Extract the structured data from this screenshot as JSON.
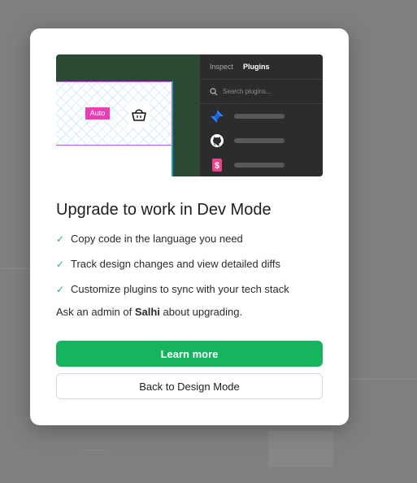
{
  "preview": {
    "auto_tag": "Auto",
    "panel": {
      "tabs": [
        "Inspect",
        "Plugins"
      ],
      "active_tab": "Plugins",
      "search_placeholder": "Search plugins...",
      "plugins": [
        {
          "icon": "jira-icon",
          "color": "#2684ff"
        },
        {
          "icon": "github-icon",
          "color": "#ffffff"
        },
        {
          "icon": "dollar-icon",
          "color": "#e8438e"
        }
      ]
    },
    "colors": {
      "panel_bg": "#2c2c2c",
      "canvas_bg": "#2a4a34"
    }
  },
  "dialog": {
    "title": "Upgrade to work in Dev Mode",
    "features": [
      "Copy code in the language you need",
      "Track design changes and view detailed diffs",
      "Customize plugins to sync with your tech stack"
    ],
    "admin_prefix": "Ask an admin of ",
    "admin_org": "Salhi",
    "admin_suffix": " about upgrading.",
    "primary_button": "Learn more",
    "secondary_button": "Back to Design Mode"
  },
  "colors": {
    "accent": "#17b35f",
    "check": "#1bb56a"
  }
}
